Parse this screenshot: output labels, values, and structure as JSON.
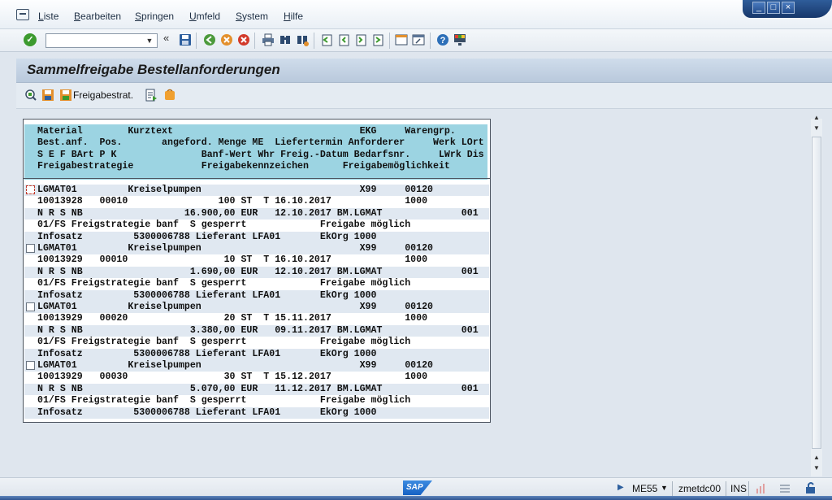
{
  "menubar": {
    "items": [
      "Liste",
      "Bearbeiten",
      "Springen",
      "Umfeld",
      "System",
      "Hilfe"
    ]
  },
  "window_controls": [
    "minimize-icon",
    "maximize-icon",
    "close-icon"
  ],
  "toolbar": {
    "command_field_value": "",
    "icons": [
      "enter-icon",
      "back-arrows-icon",
      "save-icon",
      "back-icon",
      "exit-icon",
      "cancel-icon",
      "print-icon",
      "find-icon",
      "find-next-icon",
      "first-page-icon",
      "previous-page-icon",
      "next-page-icon",
      "last-page-icon",
      "create-session-icon",
      "shortcut-icon",
      "help-icon",
      "customize-layout-icon"
    ]
  },
  "title": "Sammelfreigabe Bestellanforderungen",
  "app_toolbar": {
    "release_strategy_label": "Freigabestrat.",
    "icons": [
      "details-icon",
      "save-release-icon",
      "release-strategy-icon",
      "export-icon",
      "lock-icon"
    ]
  },
  "list": {
    "header_lines": [
      "Material        Kurztext                                 EKG     Warengrp.",
      "Best.anf.  Pos.       angeford. Menge ME  Liefertermin Anforderer     Werk LOrt",
      "S E F BArt P K               Banf-Wert Whr Freig.-Datum Bedarfsnr.     LWrk Dis",
      "Freigabestrategie            Freigabekennzeichen      Freigabemöglichkeit"
    ],
    "records": [
      {
        "lines": [
          "LGMAT01         Kreiselpumpen                            X99     00120",
          "10013928   00010                100 ST  T 16.10.2017             1000",
          "N R S NB                  16.900,00 EUR   12.10.2017 BM.LGMAT              001",
          "01/FS Freigstrategie banf  S gesperrt             Freigabe möglich",
          "Infosatz         5300006788 Lieferant LFA01       EkOrg 1000"
        ]
      },
      {
        "lines": [
          "LGMAT01         Kreiselpumpen                            X99     00120",
          "10013929   00010                 10 ST  T 16.10.2017             1000",
          "N R S NB                   1.690,00 EUR   12.10.2017 BM.LGMAT              001",
          "01/FS Freigstrategie banf  S gesperrt             Freigabe möglich",
          "Infosatz         5300006788 Lieferant LFA01       EkOrg 1000"
        ]
      },
      {
        "lines": [
          "LGMAT01         Kreiselpumpen                            X99     00120",
          "10013929   00020                 20 ST  T 15.11.2017             1000",
          "N R S NB                   3.380,00 EUR   09.11.2017 BM.LGMAT              001",
          "01/FS Freigstrategie banf  S gesperrt             Freigabe möglich",
          "Infosatz         5300006788 Lieferant LFA01       EkOrg 1000"
        ]
      },
      {
        "lines": [
          "LGMAT01         Kreiselpumpen                            X99     00120",
          "10013929   00030                 30 ST  T 15.12.2017             1000",
          "N R S NB                   5.070,00 EUR   11.12.2017 BM.LGMAT              001",
          "01/FS Freigstrategie banf  S gesperrt             Freigabe möglich",
          "Infosatz         5300006788 Lieferant LFA01       EkOrg 1000"
        ]
      }
    ]
  },
  "statusbar": {
    "logo_text": "SAP",
    "transaction": "ME55",
    "server": "zmetdc00",
    "mode": "INS"
  },
  "colors": {
    "header_bg": "#9cd4e2",
    "row_band": "#e0e8f1",
    "title_bg": "#c4d3e4",
    "ok_green": "#3c9a2e"
  }
}
